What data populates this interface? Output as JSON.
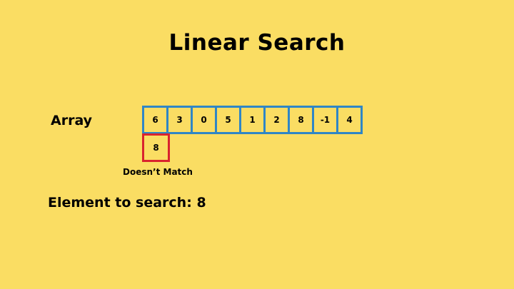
{
  "title": "Linear Search",
  "array_label": "Array",
  "array": [
    "6",
    "3",
    "0",
    "5",
    "1",
    "2",
    "8",
    "-1",
    "4"
  ],
  "probe": {
    "value": "8",
    "index": 0,
    "status": "Doesn’t Match"
  },
  "search": {
    "label": "Element to search:",
    "value": "8"
  },
  "colors": {
    "background": "#fadd63",
    "cell_border": "#2f86c6",
    "probe_border": "#d9232e"
  }
}
